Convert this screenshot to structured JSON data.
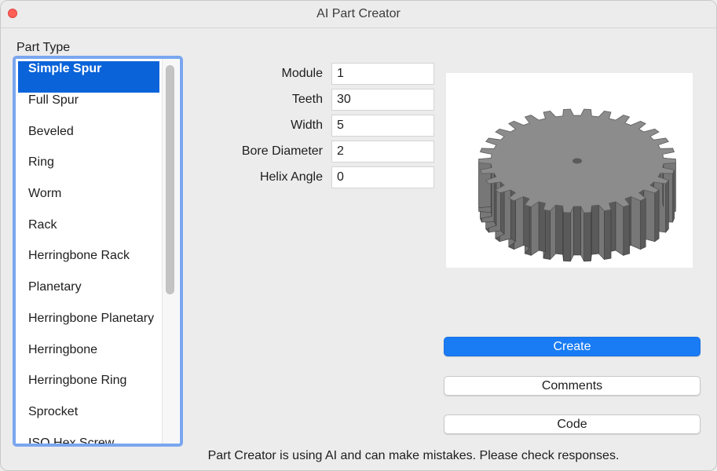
{
  "window": {
    "title": "AI Part Creator"
  },
  "part_type": {
    "label": "Part Type",
    "selected_index": 0,
    "items": [
      "Simple Spur",
      "Full Spur",
      "Beveled",
      "Ring",
      "Worm",
      "Rack",
      "Herringbone Rack",
      "Planetary",
      "Herringbone Planetary",
      "Herringbone",
      "Herringbone Ring",
      "Sprocket",
      "ISO Hex Screw"
    ]
  },
  "params": [
    {
      "label": "Module",
      "value": "1"
    },
    {
      "label": "Teeth",
      "value": "30"
    },
    {
      "label": "Width",
      "value": "5"
    },
    {
      "label": "Bore Diameter",
      "value": "2"
    },
    {
      "label": "Helix Angle",
      "value": "0"
    }
  ],
  "buttons": {
    "create": "Create",
    "comments": "Comments",
    "code": "Code"
  },
  "footer": "Part Creator is using AI and can make mistakes. Please check responses.",
  "colors": {
    "accent": "#1a7cf5",
    "selection": "#0a63d9",
    "focus_ring": "#7aa6ef",
    "gear": "#8c8c8c"
  }
}
